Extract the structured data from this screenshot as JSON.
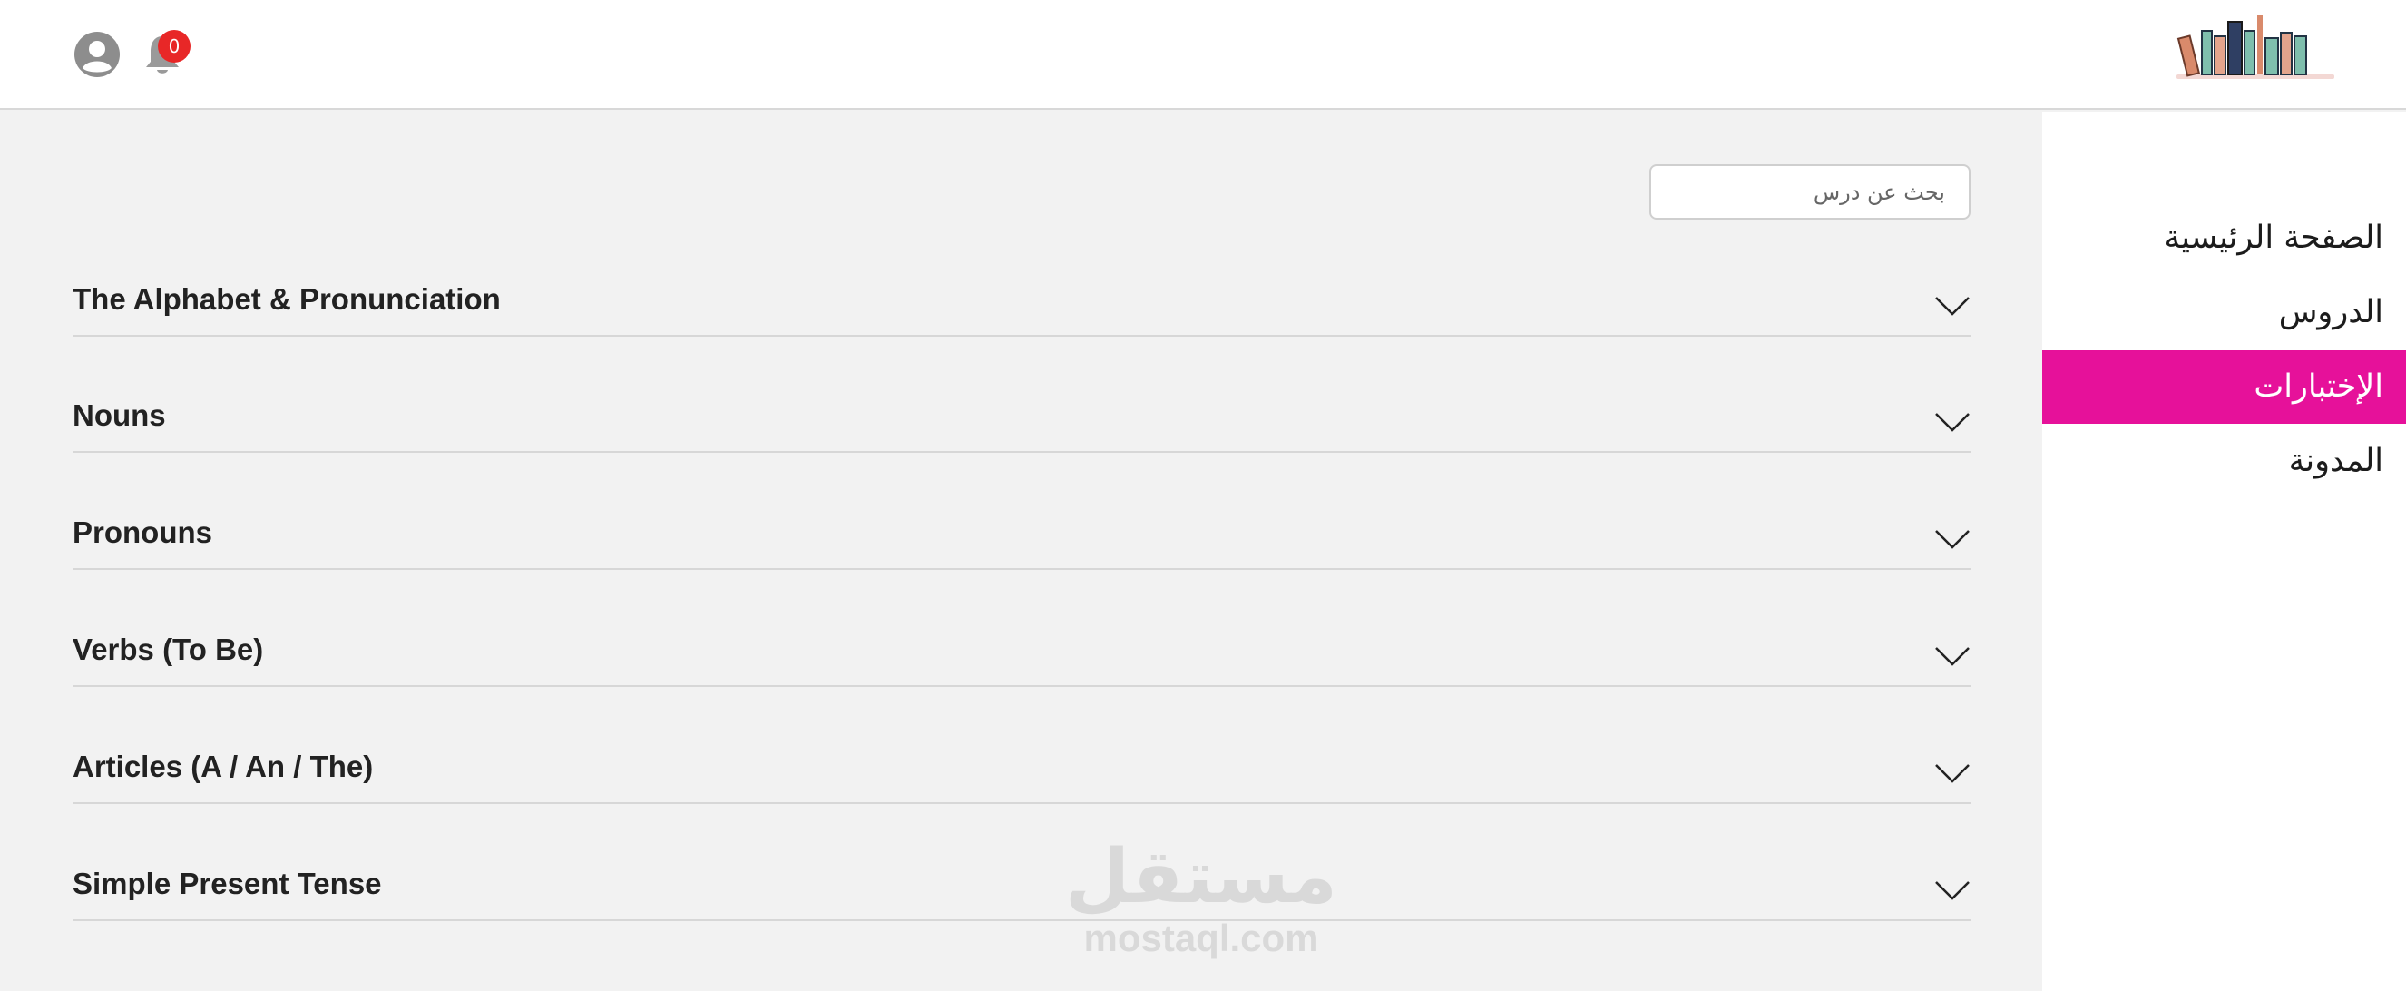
{
  "header": {
    "notification_count": "0",
    "icons": {
      "user": "user-circle-icon",
      "notifications": "bell-icon",
      "logo": "books-logo"
    }
  },
  "sidebar": {
    "items": [
      {
        "label": "الصفحة الرئيسية",
        "active": false
      },
      {
        "label": "الدروس",
        "active": false
      },
      {
        "label": "الإختبارات",
        "active": true
      },
      {
        "label": "المدونة",
        "active": false
      }
    ],
    "active_color": "#e6119a"
  },
  "search": {
    "placeholder": "بحث عن درس",
    "value": ""
  },
  "lessons": [
    {
      "title": "The Alphabet & Pronunciation"
    },
    {
      "title": "Nouns"
    },
    {
      "title": "Pronouns"
    },
    {
      "title": "Verbs (To Be)"
    },
    {
      "title": "Articles (A / An / The)"
    },
    {
      "title": "Simple Present Tense"
    }
  ],
  "watermark": {
    "arabic": "مستقل",
    "latin": "mostaql.com"
  }
}
